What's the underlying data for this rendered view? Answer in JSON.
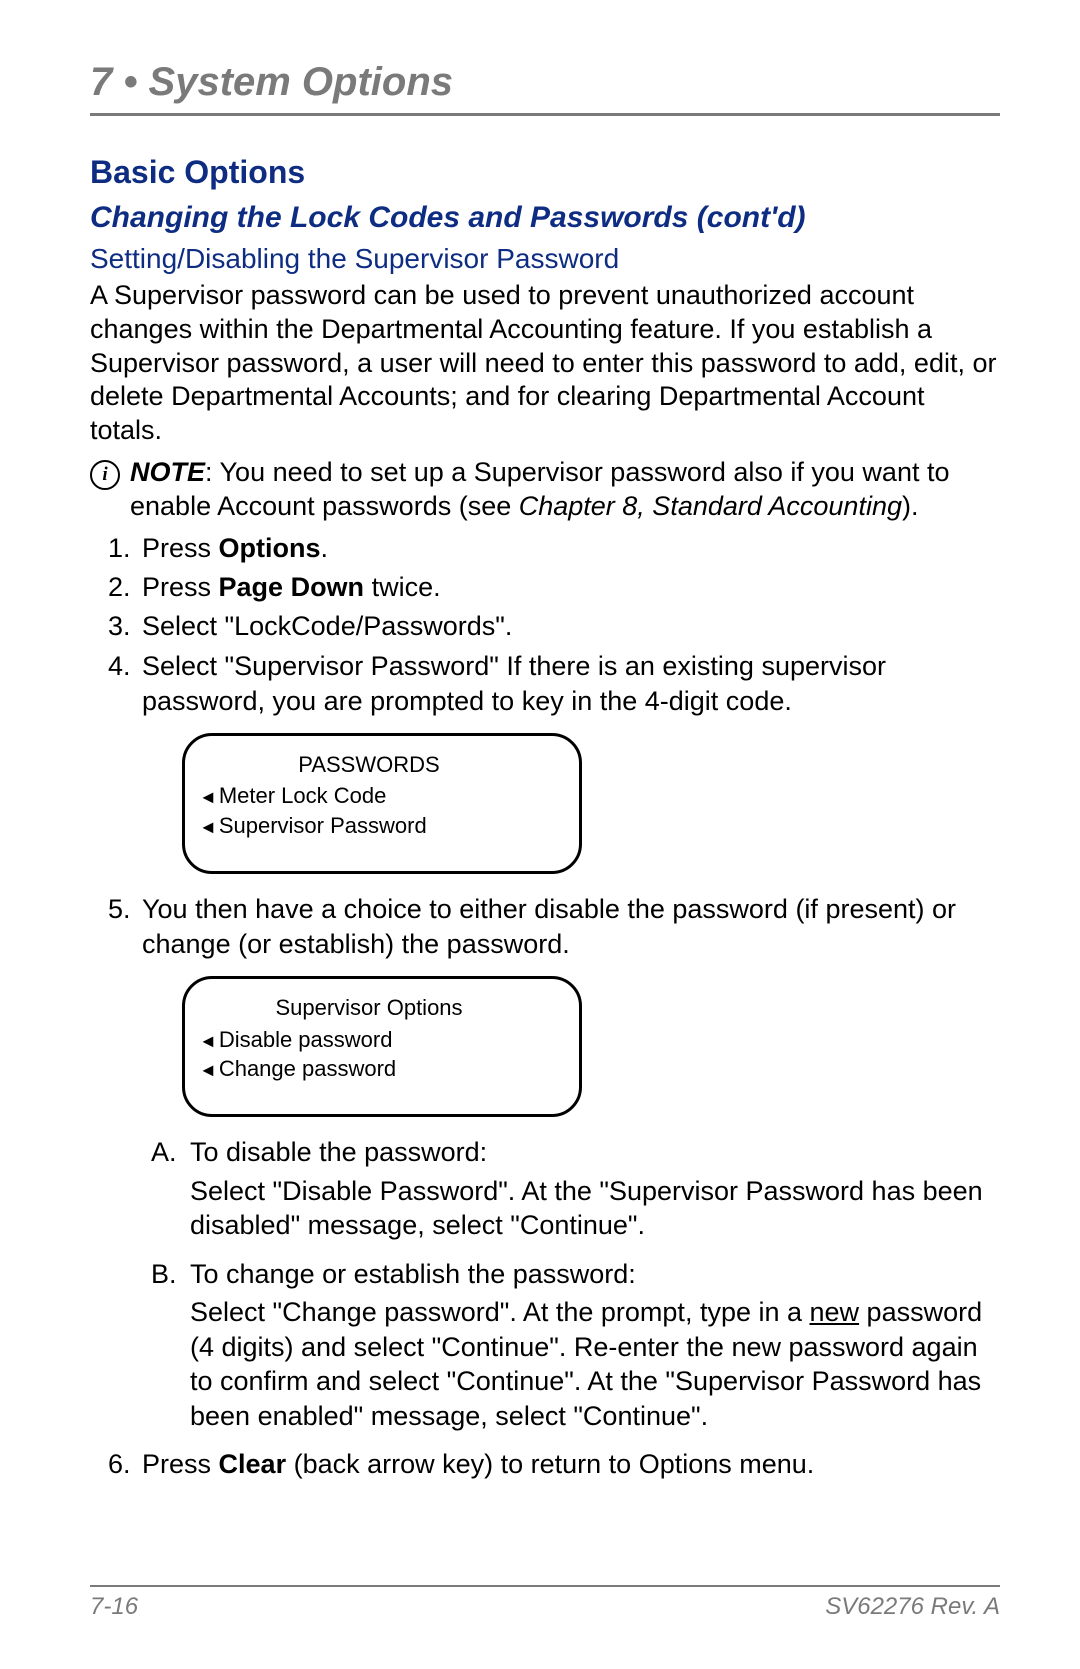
{
  "chapter": {
    "number": "7",
    "bullet": "•",
    "title": "System Options"
  },
  "section": {
    "heading": "Basic Options"
  },
  "subsection": {
    "heading": "Changing the Lock Codes and Passwords (cont'd)"
  },
  "subsubsection": {
    "heading": "Setting/Disabling the Supervisor Password"
  },
  "intro_paragraph": "A Supervisor password can be used to prevent unauthorized account changes within the Departmental Accounting feature. If you establish a Supervisor password, a user will need to enter this password to add, edit, or delete Departmental Accounts; and for clearing Departmental Account totals.",
  "note": {
    "label": "NOTE",
    "text_before_ref": ": You need to set up a Supervisor password also if you want to enable Account passwords (see ",
    "reference": "Chapter 8, Standard Accounting",
    "text_after_ref": ")."
  },
  "steps": {
    "s1_prefix": "Press ",
    "s1_bold": "Options",
    "s1_suffix": ".",
    "s2_prefix": "Press ",
    "s2_bold": "Page Down",
    "s2_suffix": " twice.",
    "s3": "Select \"LockCode/Passwords\".",
    "s4": "Select \"Supervisor Password\" If there is an existing supervisor password, you are prompted to key in the 4-digit code.",
    "s5": "You then have a choice to either disable the password (if present) or change (or establish) the password.",
    "s6_prefix": "Press ",
    "s6_bold": "Clear",
    "s6_suffix": " (back arrow key) to return to Options menu."
  },
  "screen1": {
    "title": "PASSWORDS",
    "line1": "Meter Lock Code",
    "line2": "Supervisor Password"
  },
  "screen2": {
    "title": "Supervisor Options",
    "line1": "Disable password",
    "line2": "Change password"
  },
  "substeps": {
    "a_head": "To disable the password:",
    "a_body": "Select \"Disable Password\". At the \"Supervisor Password has been disabled\" message, select \"Continue\".",
    "b_head": "To change or establish the password:",
    "b_body_before": "Select \"Change password\". At the prompt, type in a ",
    "b_body_underlined": "new",
    "b_body_after": " password (4 digits) and select \"Continue\". Re-enter the new password again to confirm and select \"Continue\". At the \"Supervisor Password has been enabled\" message, select \"Continue\"."
  },
  "footer": {
    "page": "7-16",
    "doc": "SV62276 Rev. A"
  }
}
